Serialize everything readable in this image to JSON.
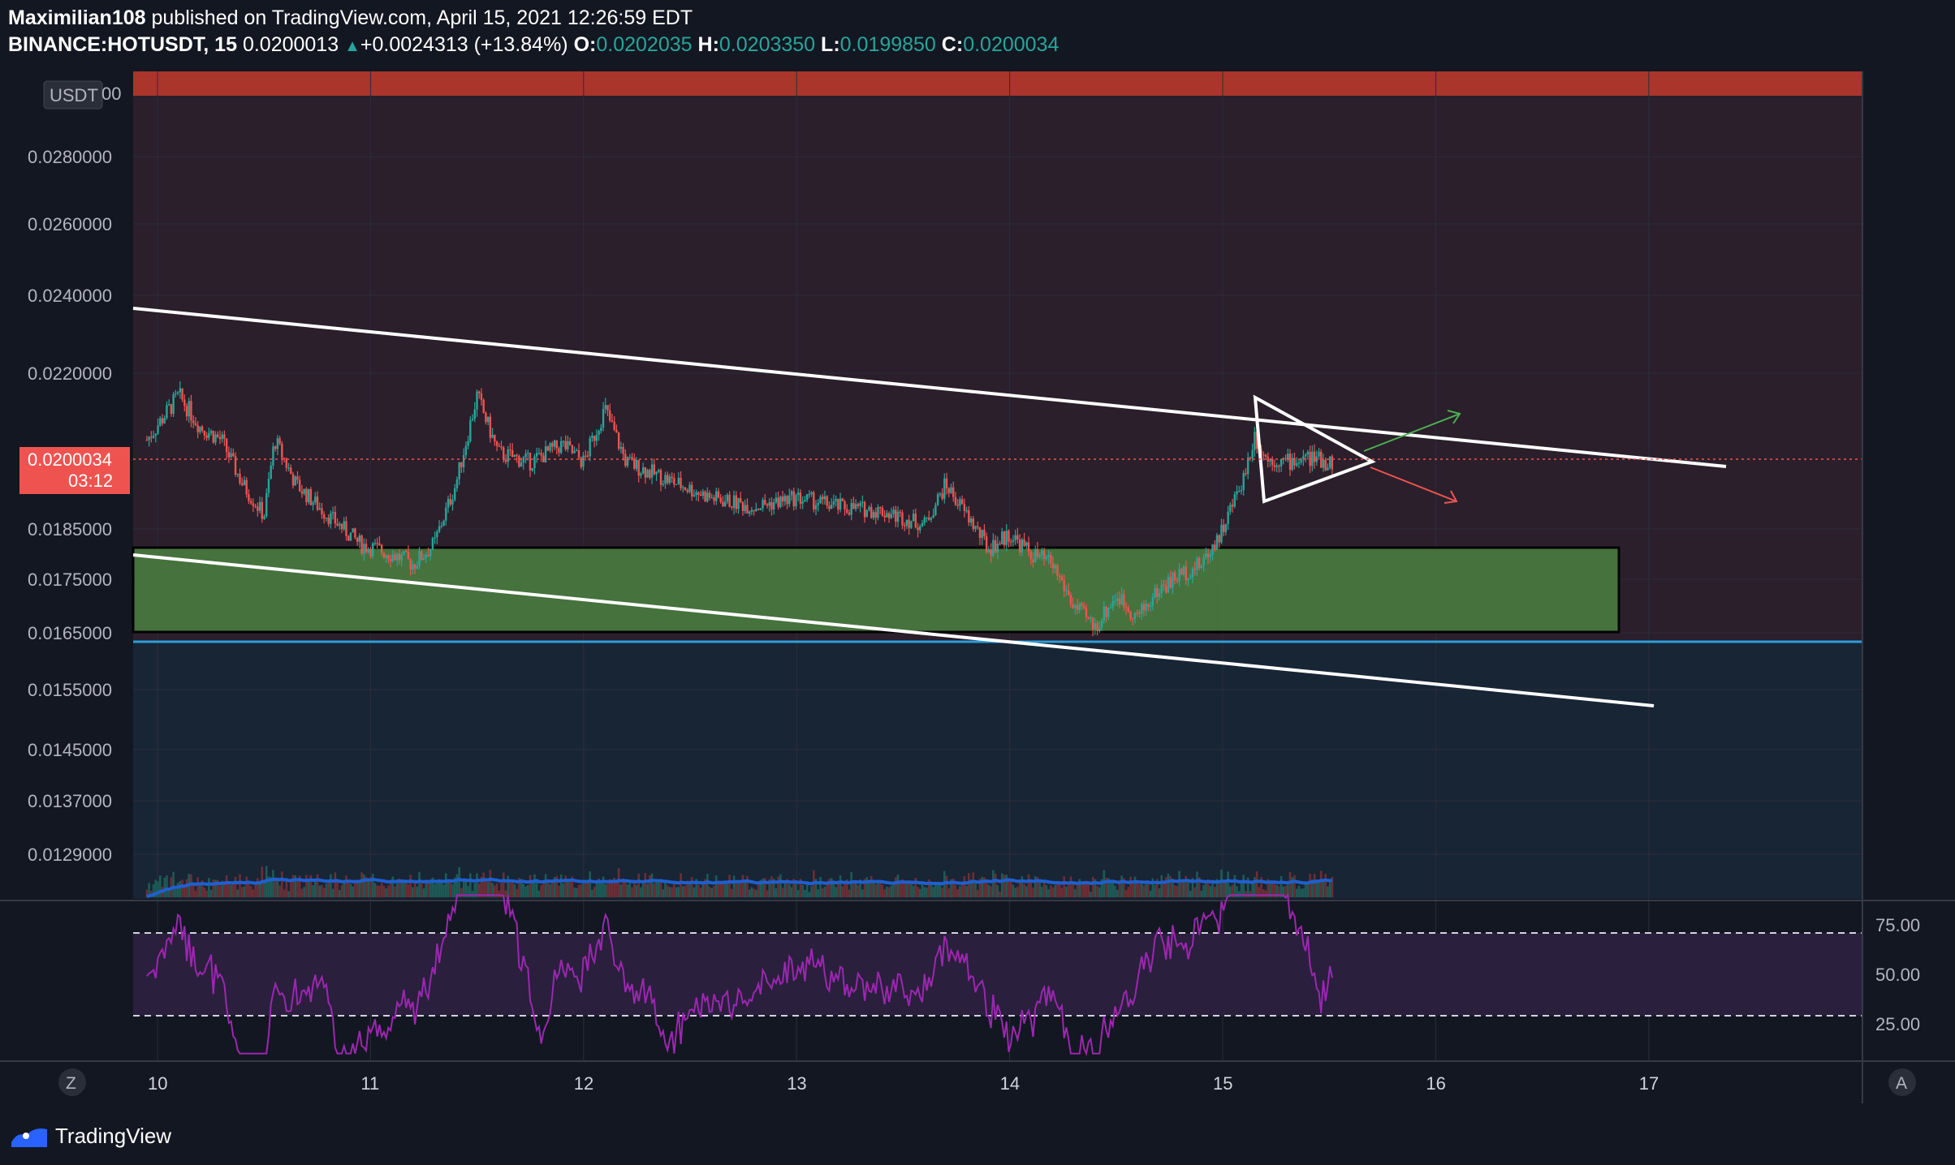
{
  "header": {
    "author": "Maximilian108",
    "published_text": "published on TradingView.com, April 15, 2021 12:26:59 EDT",
    "symbol": "BINANCE:HOTUSDT, 15",
    "last": "0.0200013",
    "change": "+0.0024313 (+13.84%)",
    "o_label": "O:",
    "o_value": "0.0202035",
    "h_label": "H:",
    "h_value": "0.0203350",
    "l_label": "L:",
    "l_value": "0.0199850",
    "c_label": "C:",
    "c_value": "0.0200034"
  },
  "price_axis": {
    "currency": "USDT",
    "top_partial_label": "00",
    "labels": [
      "0.0280000",
      "0.0260000",
      "0.0240000",
      "0.0220000",
      "0.0185000",
      "0.0175000",
      "0.0165000",
      "0.0155000",
      "0.0145000",
      "0.0137000",
      "0.0129000"
    ],
    "current_price": "0.0200034",
    "countdown": "03:12"
  },
  "rsi_axis": {
    "labels": [
      "75.00",
      "50.00",
      "25.00"
    ]
  },
  "time_axis": {
    "labels": [
      "10",
      "11",
      "12",
      "13",
      "14",
      "15",
      "16",
      "17"
    ],
    "left_button": "Z",
    "right_button": "A"
  },
  "footer": {
    "brand": "TradingView"
  },
  "colors": {
    "background": "#131722",
    "resistance_zone": "#c0392b",
    "upper_band": "#2a1f2b",
    "support_zone": "#4a7c3f",
    "support_line": "#2b9ed8",
    "lower_band": "#182535",
    "candle_up": "#26a69a",
    "candle_down": "#ef5350",
    "volume_ma": "#1f5fd0",
    "rsi_line": "#9c27b0",
    "rsi_band": "#2a1f3d"
  },
  "chart_data": {
    "type": "candlestick",
    "x_labels": [
      "10",
      "11",
      "12",
      "13",
      "14",
      "15",
      "16",
      "17"
    ],
    "y_axis_labels": [
      "0.0280000",
      "0.0260000",
      "0.0240000",
      "0.0220000",
      "0.0185000",
      "0.0175000",
      "0.0165000",
      "0.0155000",
      "0.0145000",
      "0.0137000",
      "0.0129000"
    ],
    "close_series": {
      "x_day": [
        9.95,
        10.1,
        10.2,
        10.3,
        10.4,
        10.5,
        10.55,
        10.65,
        10.8,
        10.95,
        11.1,
        11.2,
        11.3,
        11.4,
        11.5,
        11.6,
        11.75,
        11.9,
        12.0,
        12.1,
        12.2,
        12.4,
        12.6,
        12.8,
        13.0,
        13.2,
        13.4,
        13.6,
        13.7,
        13.8,
        13.9,
        14.0,
        14.1,
        14.2,
        14.3,
        14.4,
        14.5,
        14.6,
        14.7,
        14.8,
        14.9,
        15.0,
        15.1,
        15.15,
        15.2,
        15.3,
        15.4,
        15.5
      ],
      "close": [
        0.0205,
        0.0215,
        0.0208,
        0.0205,
        0.0195,
        0.0188,
        0.0205,
        0.0195,
        0.0188,
        0.0182,
        0.018,
        0.0178,
        0.0182,
        0.0195,
        0.0215,
        0.0202,
        0.02,
        0.0204,
        0.02,
        0.0212,
        0.02,
        0.0196,
        0.0192,
        0.019,
        0.0192,
        0.019,
        0.0189,
        0.0186,
        0.0195,
        0.0188,
        0.0181,
        0.0184,
        0.018,
        0.0178,
        0.017,
        0.0166,
        0.0172,
        0.0168,
        0.0173,
        0.0176,
        0.0178,
        0.0185,
        0.0197,
        0.0206,
        0.0201,
        0.02,
        0.0201,
        0.02
      ]
    },
    "rsi_levels": [
      75,
      50,
      25
    ]
  }
}
